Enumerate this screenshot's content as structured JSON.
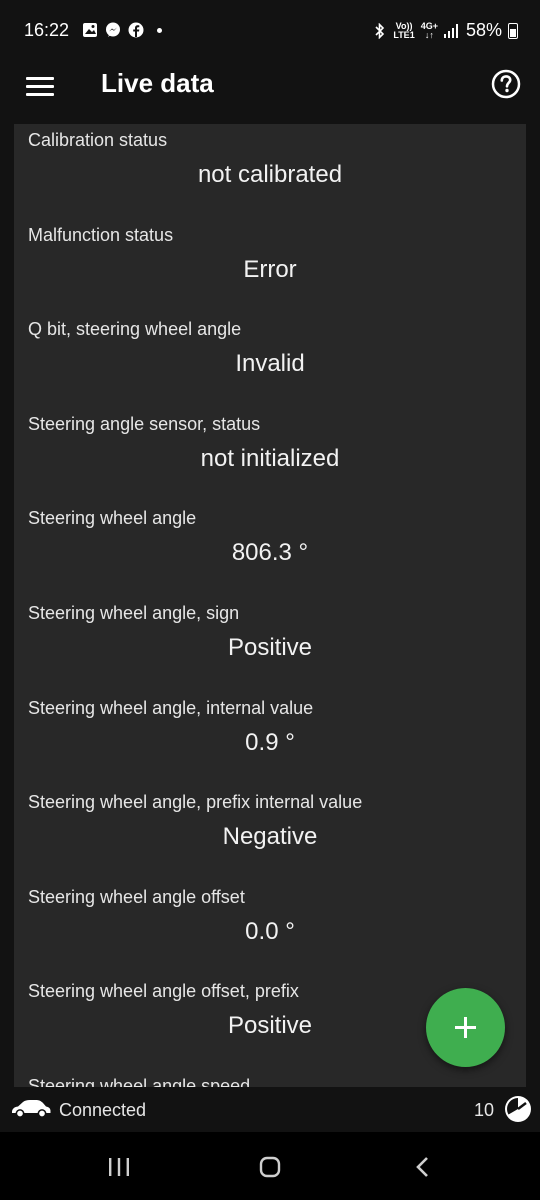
{
  "status_bar": {
    "time": "16:22",
    "left_icons": [
      "gallery-icon",
      "messenger-icon",
      "facebook-icon",
      "dot-icon"
    ],
    "network_label_top": "Vo))",
    "network_label_bottom": "LTE1",
    "data_label_top": "4G+",
    "battery": "58%"
  },
  "app_bar": {
    "title": "Live data",
    "menu_icon": "hamburger-menu-icon",
    "help_icon": "help-circle-icon"
  },
  "items": [
    {
      "label": "Calibration status",
      "value": "not calibrated"
    },
    {
      "label": "Malfunction status",
      "value": "Error"
    },
    {
      "label": "Q bit, steering wheel angle",
      "value": "Invalid"
    },
    {
      "label": "Steering angle sensor, status",
      "value": "not initialized"
    },
    {
      "label": "Steering wheel angle",
      "value": "806.3 °"
    },
    {
      "label": "Steering wheel angle, sign",
      "value": "Positive"
    },
    {
      "label": "Steering wheel angle, internal value",
      "value": "0.9 °"
    },
    {
      "label": "Steering wheel angle, prefix internal value",
      "value": "Negative"
    },
    {
      "label": "Steering wheel angle offset",
      "value": "0.0 °"
    },
    {
      "label": "Steering wheel angle offset, prefix",
      "value": "Positive"
    },
    {
      "label": "Steering wheel angle speed",
      "value": ""
    }
  ],
  "fab": {
    "icon": "plus-icon"
  },
  "connection": {
    "status": "Connected",
    "count": "10"
  },
  "colors": {
    "background": "#121212",
    "card": "#282828",
    "accent": "#3fae4f"
  }
}
